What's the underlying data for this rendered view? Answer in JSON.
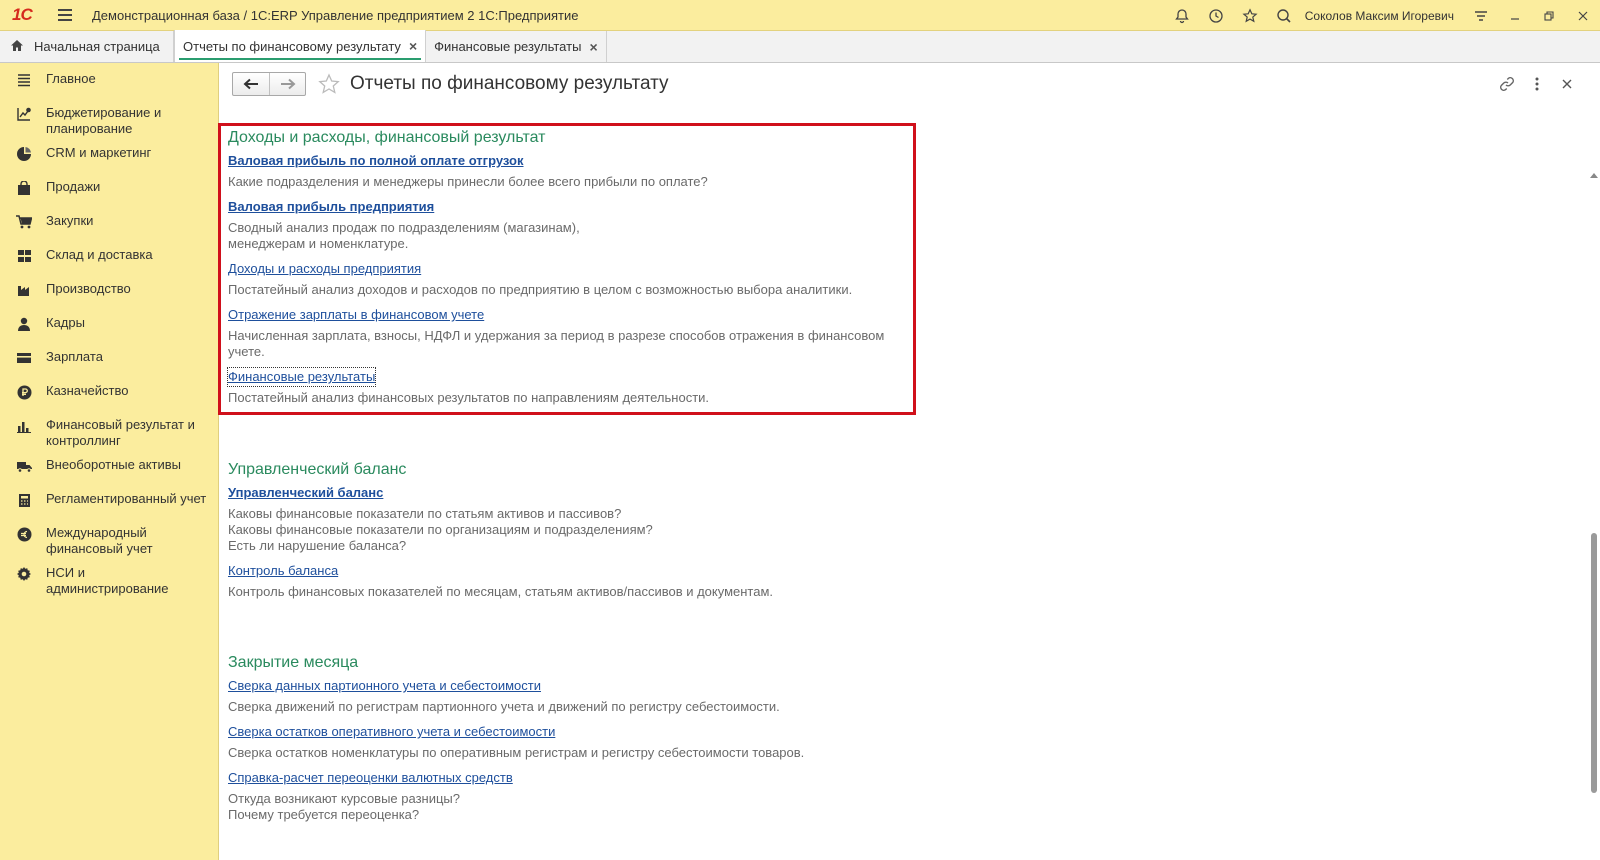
{
  "window": {
    "title": "Демонстрационная база / 1С:ERP Управление предприятием 2 1С:Предприятие",
    "logo": "1С",
    "user": "Соколов Максим Игоревич"
  },
  "tabs": [
    {
      "label": "Начальная страница"
    },
    {
      "label": "Отчеты по финансовому результату"
    },
    {
      "label": "Финансовые результаты"
    }
  ],
  "sidebar": {
    "items": [
      {
        "label": "Главное",
        "icon": "list-icon"
      },
      {
        "label": "Бюджетирование и планирование",
        "icon": "budget-icon"
      },
      {
        "label": "CRM и маркетинг",
        "icon": "crm-icon"
      },
      {
        "label": "Продажи",
        "icon": "bag-icon"
      },
      {
        "label": "Закупки",
        "icon": "cart-icon"
      },
      {
        "label": "Склад и доставка",
        "icon": "warehouse-icon"
      },
      {
        "label": "Производство",
        "icon": "factory-icon"
      },
      {
        "label": "Кадры",
        "icon": "person-icon"
      },
      {
        "label": "Зарплата",
        "icon": "wallet-icon"
      },
      {
        "label": "Казначейство",
        "icon": "ruble-icon"
      },
      {
        "label": "Финансовый результат и контроллинг",
        "icon": "bar-chart-icon"
      },
      {
        "label": "Внеоборотные активы",
        "icon": "truck-icon"
      },
      {
        "label": "Регламентированный учет",
        "icon": "calculator-icon"
      },
      {
        "label": "Международный финансовый учет",
        "icon": "euro-icon"
      },
      {
        "label": "НСИ и администрирование",
        "icon": "gear-icon"
      }
    ]
  },
  "page": {
    "title": "Отчеты по финансовому результату"
  },
  "groups": [
    {
      "title": "Доходы и расходы, финансовый результат",
      "reports": [
        {
          "link": "Валовая прибыль по полной оплате отгрузок",
          "desc": "Какие подразделения и менеджеры принесли более всего прибыли по оплате?"
        },
        {
          "link": "Валовая прибыль предприятия",
          "desc": "Сводный анализ продаж по подразделениям (магазинам),\nменеджерам и номенклатуре."
        },
        {
          "link": "Доходы и расходы предприятия",
          "desc": "Постатейный анализ доходов и расходов по предприятию в целом с возможностью выбора аналитики."
        },
        {
          "link": "Отражение зарплаты в финансовом учете",
          "desc": "Начисленная зарплата, взносы, НДФЛ и удержания за период в разрезе способов отражения в финансовом учете."
        },
        {
          "link": "Финансовые результаты",
          "desc": "Постатейный анализ финансовых результатов по направлениям деятельности."
        }
      ]
    },
    {
      "title": "Управленческий баланс",
      "reports": [
        {
          "link": "Управленческий баланс",
          "desc": "Каковы финансовые показатели по статьям активов и пассивов?\nКаковы финансовые показатели по организациям и подразделениям?\nЕсть ли нарушение баланса?"
        },
        {
          "link": "Контроль баланса",
          "desc": "Контроль финансовых показателей по месяцам, статьям активов/пассивов и документам."
        }
      ]
    },
    {
      "title": "Закрытие месяца",
      "reports": [
        {
          "link": "Сверка данных партионного учета и себестоимости",
          "desc": "Сверка движений по регистрам партионного учета и движений по регистру себестоимости."
        },
        {
          "link": "Сверка остатков оперативного учета и себестоимости",
          "desc": "Сверка остатков номенклатуры по оперативным регистрам и регистру себестоимости товаров."
        },
        {
          "link": "Справка-расчет переоценки валютных средств",
          "desc": "Откуда возникают курсовые разницы?\nПочему требуется переоценка?"
        }
      ]
    }
  ]
}
